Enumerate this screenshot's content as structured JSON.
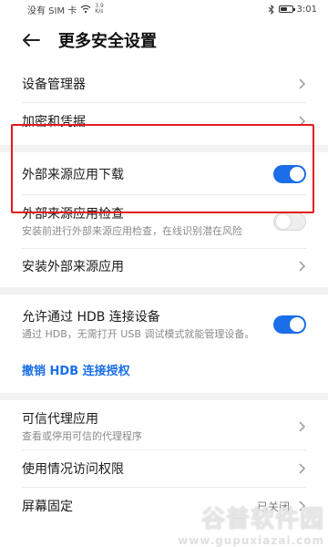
{
  "status_bar": {
    "carrier": "没有 SIM 卡",
    "speed_top": "3.9",
    "speed_unit": "K/s",
    "time": "3:01",
    "battery_level": 0.55
  },
  "header": {
    "title": "更多安全设置"
  },
  "rows": {
    "device_admin": {
      "label": "设备管理器"
    },
    "encryption": {
      "label": "加密和凭据"
    },
    "external_download": {
      "label": "外部来源应用下载",
      "toggle": "on"
    },
    "external_check": {
      "label": "外部来源应用检查",
      "desc": "安装前进行外部来源应用检查，在线识别潜在风险",
      "toggle": "off"
    },
    "install_external": {
      "label": "安装外部来源应用"
    },
    "hdb_allow": {
      "label": "允许通过 HDB 连接设备",
      "desc": "通过 HDB，无需打开 USB 调试模式就能管理设备。",
      "toggle": "on"
    },
    "hdb_revoke": {
      "label": "撤销 HDB 连接授权"
    },
    "trust_agents": {
      "label": "可信代理应用",
      "desc": "查看或停用可信的代理程序"
    },
    "usage_access": {
      "label": "使用情况访问权限"
    },
    "screen_pin": {
      "label": "屏幕固定",
      "value": "已关闭"
    }
  },
  "watermark": {
    "main": "谷普软件园",
    "url": "www.gupuxiazai.com"
  },
  "colors": {
    "accent": "#1a6fe8",
    "highlight": "#e11b1b"
  }
}
